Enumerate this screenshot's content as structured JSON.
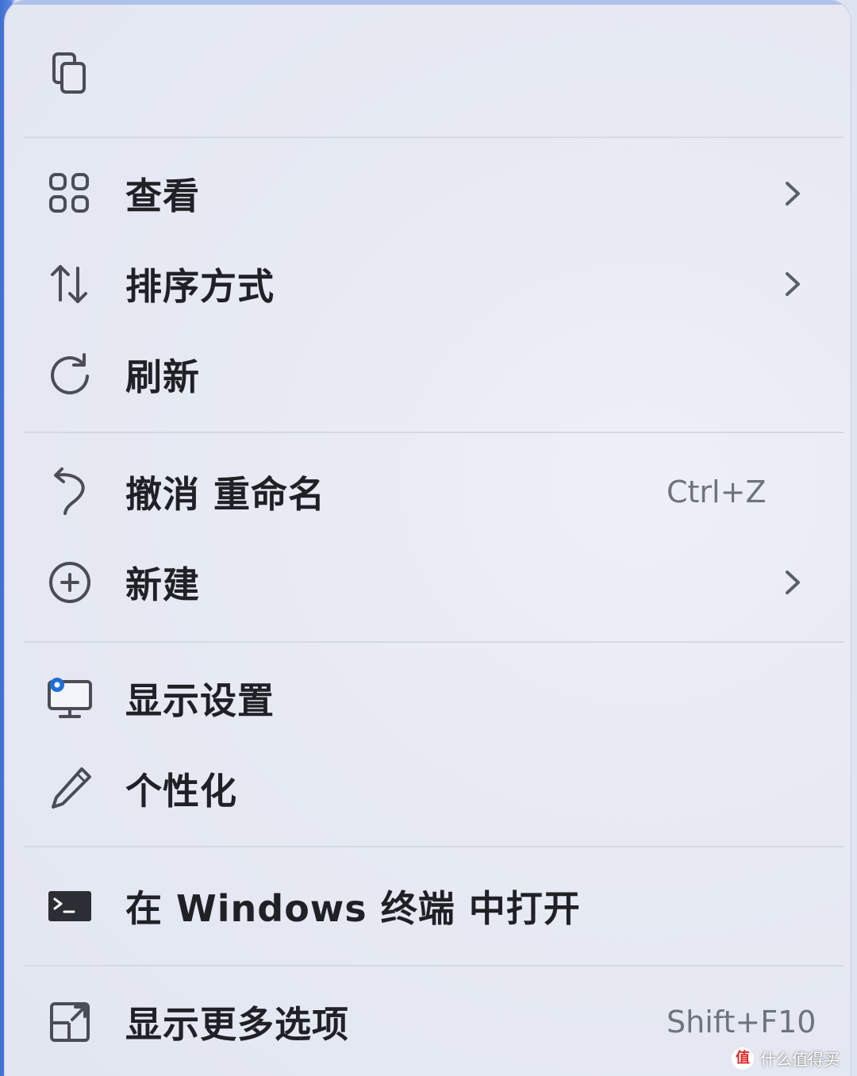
{
  "menu": {
    "top_icon": "copy-icon",
    "items": [
      {
        "label": "查看",
        "icon": "grid-view-icon",
        "submenu": true
      },
      {
        "label": "排序方式",
        "icon": "sort-arrows-icon",
        "submenu": true
      },
      {
        "label": "刷新",
        "icon": "refresh-icon",
        "submenu": false
      },
      {
        "label": "撤消 重命名",
        "icon": "undo-icon",
        "shortcut": "Ctrl+Z"
      },
      {
        "label": "新建",
        "icon": "add-circle-icon",
        "submenu": true
      },
      {
        "label": "显示设置",
        "icon": "display-settings-icon"
      },
      {
        "label": "个性化",
        "icon": "pen-icon"
      },
      {
        "label": "在 Windows 终端 中打开",
        "icon": "terminal-icon"
      },
      {
        "label": "显示更多选项",
        "icon": "more-options-icon",
        "shortcut": "Shift+F10"
      }
    ]
  },
  "watermark": {
    "badge": "值",
    "text": "什么值得买"
  },
  "colors": {
    "accent": "#4d7be0",
    "menu_background": "#e7eaf3",
    "text": "#1f2126",
    "shortcut_text": "#6f737c",
    "separator": "#d5d9e4"
  }
}
